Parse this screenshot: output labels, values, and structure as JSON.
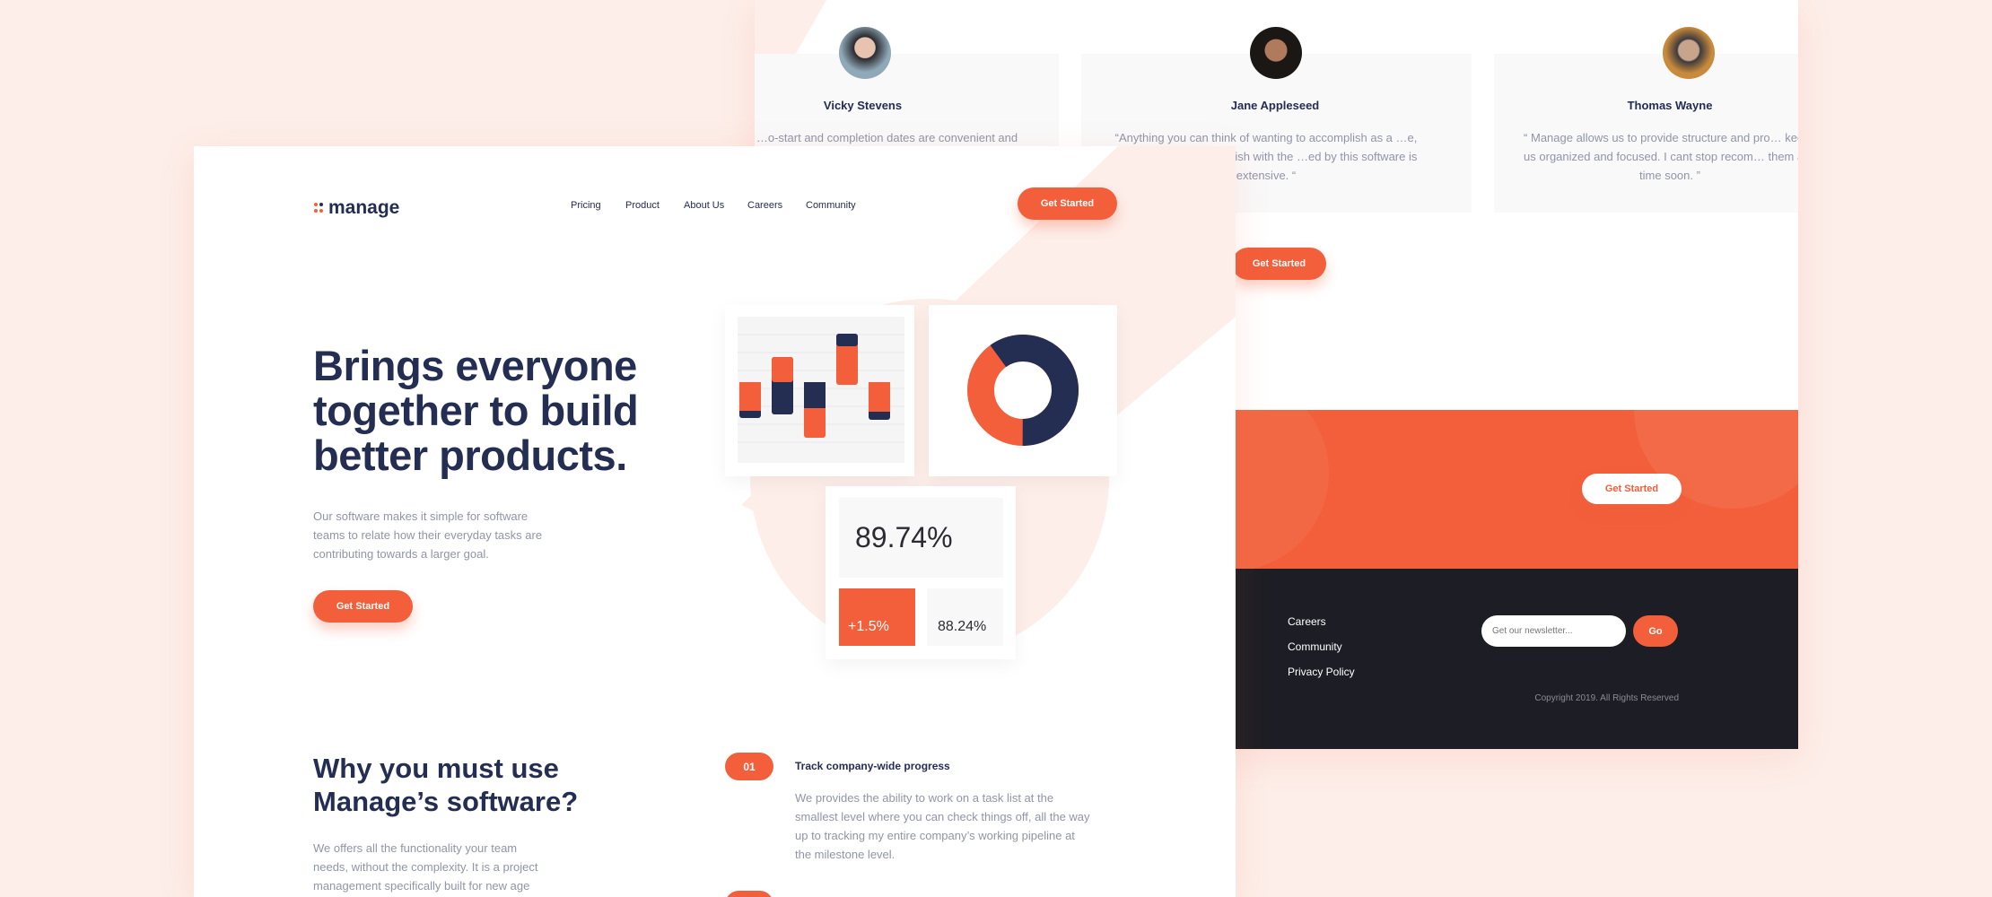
{
  "colors": {
    "accent": "#f25f3a",
    "navy": "#242d52",
    "footer": "#1d1e25",
    "bg": "#fdeee9"
  },
  "testimonials": [
    {
      "name": "Vicky Stevens",
      "quote": "…o-start and completion dates are convenient and"
    },
    {
      "name": "Jane Appleseed",
      "quote": "“Anything you can think of wanting to accomplish as a …e, your code can accomplish with the …ed by this software is extensive. “"
    },
    {
      "name": "Thomas Wayne",
      "quote": "“ Manage allows us to provide structure and pro… keeps us organized and focused. I cant stop recom… them any time soon. ”"
    }
  ],
  "back": {
    "cta_label": "Get Started",
    "banner_cta_label": "Get Started",
    "footer": {
      "links": [
        "Careers",
        "Community",
        "Privacy Policy"
      ],
      "newsletter_placeholder": "Get our newsletter...",
      "go_label": "Go",
      "copyright": "Copyright 2019. All Rights Reserved"
    }
  },
  "header": {
    "logo": "manage",
    "nav": [
      "Pricing",
      "Product",
      "About Us",
      "Careers",
      "Community"
    ],
    "cta_label": "Get Started"
  },
  "hero": {
    "title_lines": [
      "Brings everyone",
      "together to build",
      "better products."
    ],
    "description_lines": [
      "Our software makes it simple for software",
      "teams to relate how their everyday tasks are",
      "contributing towards a larger goal."
    ],
    "cta_label": "Get Started"
  },
  "stats": {
    "main": "89.74%",
    "change": "+1.5%",
    "secondary": "88.24%",
    "donut_navy_fraction": 0.6
  },
  "why": {
    "title_lines": [
      "Why you must use",
      "Manage’s software?"
    ],
    "description_lines": [
      "We offers all the functionality your team",
      "needs, without the complexity. It is a project",
      "management specifically built for new age"
    ],
    "features": [
      {
        "number": "01",
        "title": "Track company-wide progress",
        "description_lines": [
          "We provides the ability to work on a task list at the",
          "smallest level where you can check things off, all the way",
          "up to tracking my entire company’s working pipeline at",
          "the milestone level."
        ]
      }
    ]
  }
}
